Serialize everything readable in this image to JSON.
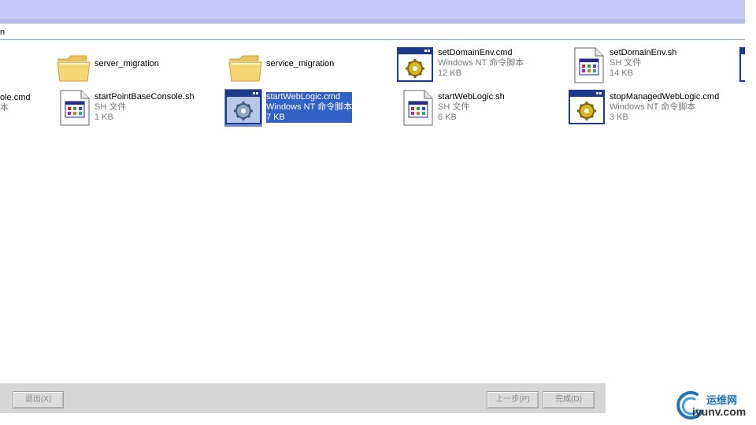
{
  "window": {
    "address_text": "n"
  },
  "files": [
    {
      "name": "server_migration",
      "type": "",
      "size": "",
      "icon": "folder-icon"
    },
    {
      "name": "service_migration",
      "type": "",
      "size": "",
      "icon": "folder-icon"
    },
    {
      "name": "setDomainEnv.cmd",
      "type": "Windows NT 命令脚本",
      "size": "12 KB",
      "icon": "cmd-script-icon"
    },
    {
      "name": "setDomainEnv.sh",
      "type": "SH 文件",
      "size": "14 KB",
      "icon": "sh-file-icon"
    },
    {
      "name": "ole.cmd",
      "type": "本",
      "size": "",
      "icon": "cmd-script-icon"
    },
    {
      "name": "startPointBaseConsole.sh",
      "type": "SH 文件",
      "size": "1 KB",
      "icon": "sh-file-icon"
    },
    {
      "name": "startWebLogic.cmd",
      "type": "Windows NT 命令脚本",
      "size": "7 KB",
      "icon": "cmd-script-icon",
      "selected": true
    },
    {
      "name": "startWebLogic.sh",
      "type": "SH 文件",
      "size": "6 KB",
      "icon": "sh-file-icon"
    },
    {
      "name": "stopManagedWebLogic.cmd",
      "type": "Windows NT 命令脚本",
      "size": "3 KB",
      "icon": "cmd-script-icon"
    }
  ],
  "footer": {
    "exit_label": "退出(X)",
    "prev_label": "上一步(P)",
    "finish_label": "完成(D)"
  },
  "watermark": {
    "text_cn": "运维网",
    "text_en": "iyunv.com"
  },
  "colors": {
    "selection": "#3161c5",
    "title_band": "#c8c8f8",
    "folder": "#f5d776",
    "icon_frame": "#1f3a8a"
  }
}
